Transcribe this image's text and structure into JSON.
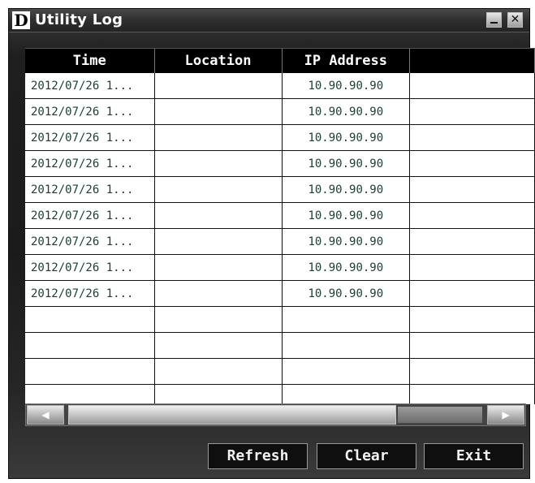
{
  "window": {
    "title": "Utility Log",
    "logo": "D"
  },
  "controls": {
    "minimize_icon": "minimize-icon",
    "close_glyph": "✕"
  },
  "table": {
    "headers": [
      "Time",
      "Location",
      "IP Address",
      ""
    ],
    "rows": [
      [
        "2012/07/26 1...",
        "",
        "10.90.90.90",
        ""
      ],
      [
        "2012/07/26 1...",
        "",
        "10.90.90.90",
        ""
      ],
      [
        "2012/07/26 1...",
        "",
        "10.90.90.90",
        ""
      ],
      [
        "2012/07/26 1...",
        "",
        "10.90.90.90",
        ""
      ],
      [
        "2012/07/26 1...",
        "",
        "10.90.90.90",
        ""
      ],
      [
        "2012/07/26 1...",
        "",
        "10.90.90.90",
        ""
      ],
      [
        "2012/07/26 1...",
        "",
        "10.90.90.90",
        ""
      ],
      [
        "2012/07/26 1...",
        "",
        "10.90.90.90",
        ""
      ],
      [
        "2012/07/26 1...",
        "",
        "10.90.90.90",
        ""
      ],
      [
        "",
        "",
        "",
        ""
      ],
      [
        "",
        "",
        "",
        ""
      ],
      [
        "",
        "",
        "",
        ""
      ],
      [
        "",
        "",
        "",
        ""
      ]
    ]
  },
  "scrollbar": {
    "left_arrow": "◀",
    "right_arrow": "▶"
  },
  "buttons": {
    "refresh": "Refresh",
    "clear": "Clear",
    "exit": "Exit"
  }
}
